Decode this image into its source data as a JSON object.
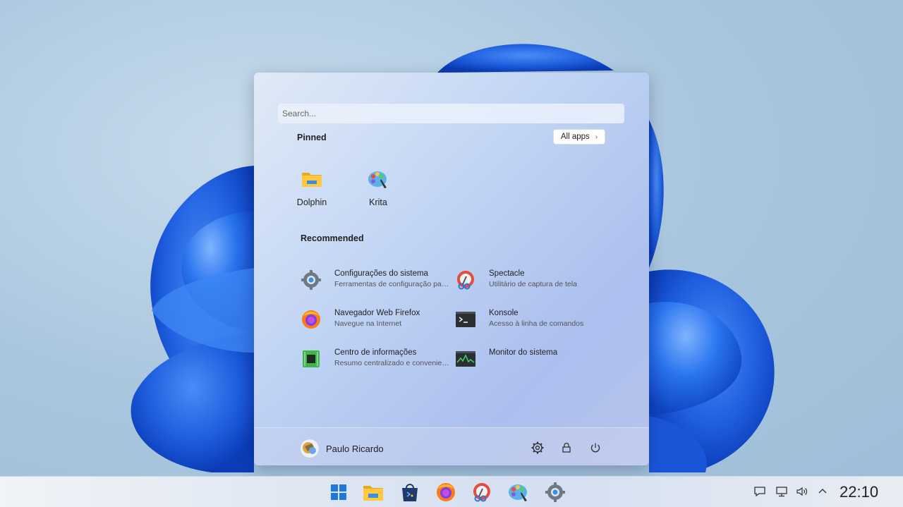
{
  "search": {
    "placeholder": "Search..."
  },
  "pinned": {
    "title": "Pinned",
    "all_apps_label": "All apps",
    "apps": [
      {
        "label": "Dolphin",
        "icon": "folder-icon"
      },
      {
        "label": "Krita",
        "icon": "krita-icon"
      }
    ]
  },
  "recommended": {
    "title": "Recommended",
    "items": [
      {
        "title": "Configurações do sistema",
        "subtitle": "Ferramentas de configuração para o computador",
        "icon": "gear-icon"
      },
      {
        "title": "Spectacle",
        "subtitle": "Utilitário de captura de tela",
        "icon": "spectacle-icon"
      },
      {
        "title": "Navegador Web Firefox",
        "subtitle": "Navegue na Internet",
        "icon": "firefox-icon"
      },
      {
        "title": "Konsole",
        "subtitle": "Acesso à linha de comandos",
        "icon": "terminal-icon"
      },
      {
        "title": "Centro de informações",
        "subtitle": "Resumo centralizado e conveniente das informações do sistema",
        "icon": "chip-icon"
      },
      {
        "title": "Monitor do sistema",
        "subtitle": "",
        "icon": "system-monitor-icon"
      }
    ]
  },
  "footer": {
    "user_name": "Paulo Ricardo",
    "buttons": [
      "settings-icon",
      "lock-icon",
      "power-icon"
    ]
  },
  "taskbar": {
    "apps": [
      "start-icon",
      "dolphin-icon",
      "discover-icon",
      "firefox-icon",
      "spectacle-icon",
      "krita-icon",
      "settings-icon"
    ],
    "tray": [
      "notifications-icon",
      "network-icon",
      "volume-icon",
      "chevron-up-icon"
    ],
    "clock": "22:10"
  },
  "colors": {
    "accent": "#1e6bd6",
    "wallpaper_blue": "#1f5fe0",
    "background": "#a9c6de"
  }
}
